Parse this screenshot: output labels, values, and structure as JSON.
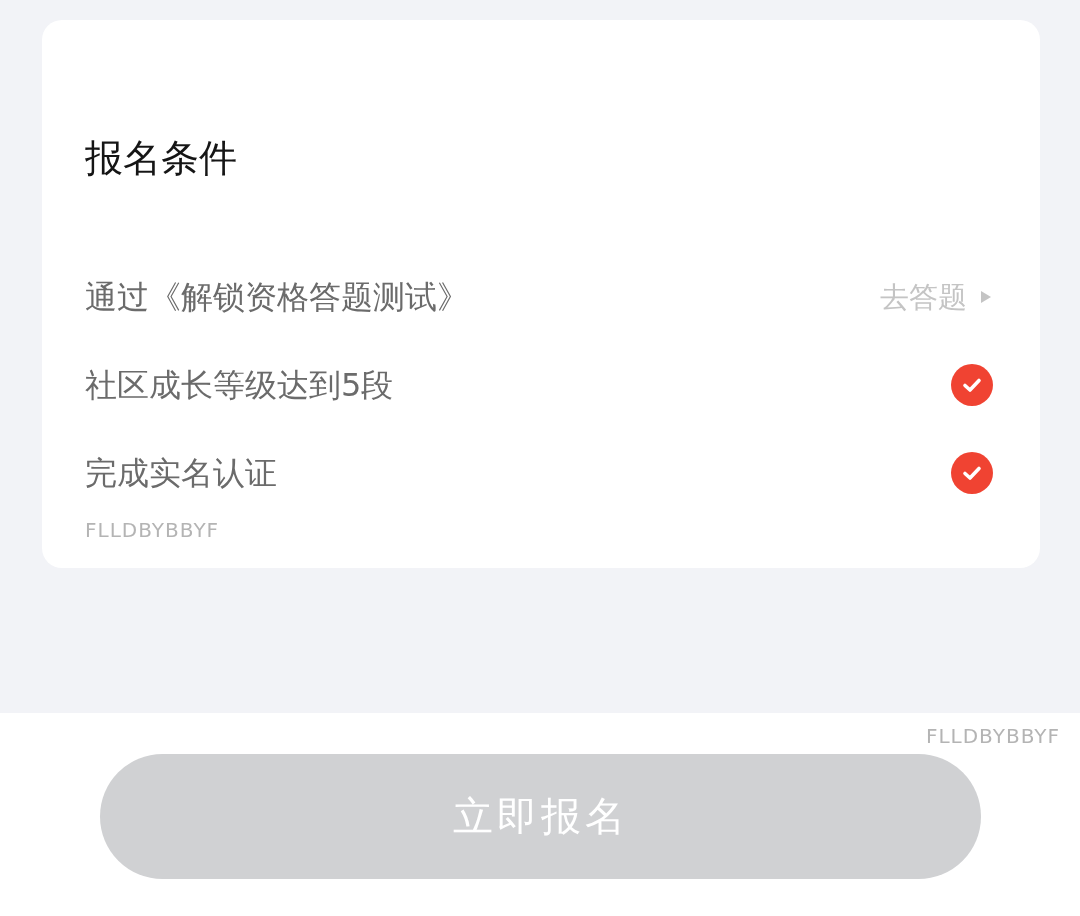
{
  "card": {
    "title": "报名条件",
    "conditions": [
      {
        "text": "通过《解锁资格答题测试》",
        "done": false,
        "action": "去答题"
      },
      {
        "text": "社区成长等级达到5段",
        "done": true
      },
      {
        "text": "完成实名认证",
        "done": true
      }
    ],
    "watermark": "FLLDBYBBYF"
  },
  "footer": {
    "watermark": "FLLDBYBBYF",
    "submit_button": {
      "label": "立即报名",
      "disabled": true
    }
  }
}
